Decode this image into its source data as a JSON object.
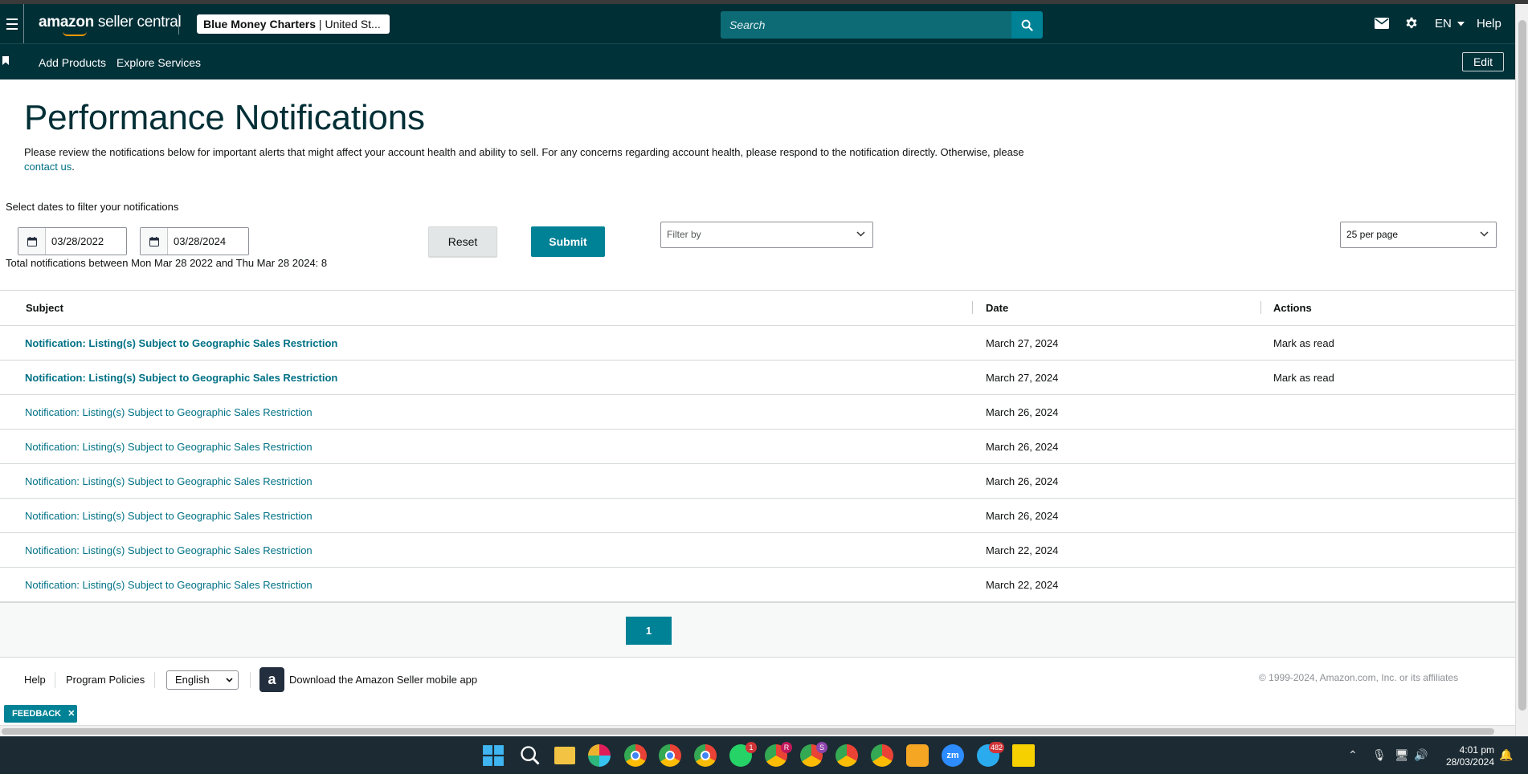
{
  "app": {
    "brand_bold": "amazon",
    "brand_rest": " seller central",
    "account_name": "Blue Money Charters",
    "account_region": " | United St..."
  },
  "header": {
    "search_placeholder": "Search",
    "language": "EN",
    "help": "Help"
  },
  "nav": {
    "links": [
      "Add Products",
      "Explore Services"
    ],
    "edit": "Edit"
  },
  "page": {
    "title": "Performance Notifications",
    "description": "Please review the notifications below for important alerts that might affect your account health and ability to sell. For any concerns regarding account health, please respond to the notification directly. Otherwise, please ",
    "contact_link": "contact us",
    "description_end": "."
  },
  "filters": {
    "label": "Select dates to filter your notifications",
    "start_date": "03/28/2022",
    "end_date": "03/28/2024",
    "total_text": "Total notifications between Mon Mar 28 2022 and Thu Mar 28 2024: 8",
    "reset_label": "Reset",
    "submit_label": "Submit",
    "filter_by_placeholder": "Filter by",
    "per_page": "25 per page"
  },
  "table": {
    "columns": [
      "Subject",
      "Date",
      "Actions"
    ],
    "rows": [
      {
        "subject": "Notification: Listing(s) Subject to Geographic Sales Restriction",
        "date": "March 27, 2024",
        "action": "Mark as read",
        "unread": true
      },
      {
        "subject": "Notification: Listing(s) Subject to Geographic Sales Restriction",
        "date": "March 27, 2024",
        "action": "Mark as read",
        "unread": true
      },
      {
        "subject": "Notification: Listing(s) Subject to Geographic Sales Restriction",
        "date": "March 26, 2024",
        "action": "",
        "unread": false
      },
      {
        "subject": "Notification: Listing(s) Subject to Geographic Sales Restriction",
        "date": "March 26, 2024",
        "action": "",
        "unread": false
      },
      {
        "subject": "Notification: Listing(s) Subject to Geographic Sales Restriction",
        "date": "March 26, 2024",
        "action": "",
        "unread": false
      },
      {
        "subject": "Notification: Listing(s) Subject to Geographic Sales Restriction",
        "date": "March 26, 2024",
        "action": "",
        "unread": false
      },
      {
        "subject": "Notification: Listing(s) Subject to Geographic Sales Restriction",
        "date": "March 22, 2024",
        "action": "",
        "unread": false
      },
      {
        "subject": "Notification: Listing(s) Subject to Geographic Sales Restriction",
        "date": "March 22, 2024",
        "action": "",
        "unread": false
      }
    ]
  },
  "pagination": {
    "current_page": "1"
  },
  "footer": {
    "help": "Help",
    "program_policies": "Program Policies",
    "language": "English",
    "app_download": "Download the Amazon Seller mobile app",
    "copyright": "© 1999-2024, Amazon.com, Inc. or its affiliates",
    "feedback": "FEEDBACK"
  },
  "taskbar": {
    "time": "4:01 pm",
    "date": "28/03/2024",
    "badges": {
      "whatsapp": "1",
      "chrome_r": "R",
      "chrome_s": "S",
      "telegram": "482"
    }
  },
  "colors": {
    "brand_dark": "#002f36",
    "teal": "#008296",
    "link": "#007185",
    "orange": "#ff9900"
  }
}
